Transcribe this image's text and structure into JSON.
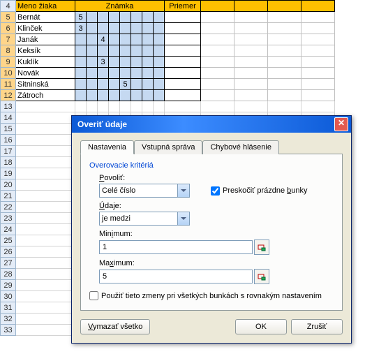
{
  "sheet": {
    "header_row": 4,
    "headers": {
      "name": "Meno žiaka",
      "grades": "Známka",
      "avg": "Priemer"
    },
    "row_numbers": [
      4,
      5,
      6,
      7,
      8,
      9,
      10,
      11,
      12,
      13,
      14,
      15,
      16,
      17,
      18,
      19,
      20,
      21,
      22,
      23,
      24,
      25,
      26,
      27,
      28,
      29,
      30,
      31,
      32,
      33
    ],
    "selected_rows": [
      5,
      6,
      7,
      8,
      9,
      10,
      11,
      12
    ],
    "rows": [
      {
        "n": 5,
        "name": "Bernát",
        "grades": [
          "5",
          "",
          "",
          "",
          "",
          "",
          "",
          ""
        ]
      },
      {
        "n": 6,
        "name": "Klinček",
        "grades": [
          "3",
          "",
          "",
          "",
          "",
          "",
          "",
          ""
        ]
      },
      {
        "n": 7,
        "name": "Janák",
        "grades": [
          "",
          "",
          "4",
          "",
          "",
          "",
          "",
          ""
        ]
      },
      {
        "n": 8,
        "name": "Keksík",
        "grades": [
          "",
          "",
          "",
          "",
          "",
          "",
          "",
          ""
        ]
      },
      {
        "n": 9,
        "name": "Kuklík",
        "grades": [
          "",
          "",
          "3",
          "",
          "",
          "",
          "",
          ""
        ]
      },
      {
        "n": 10,
        "name": "Novák",
        "grades": [
          "",
          "",
          "",
          "",
          "",
          "",
          "",
          ""
        ]
      },
      {
        "n": 11,
        "name": "Sitninská",
        "grades": [
          "",
          "",
          "",
          "",
          "5",
          "",
          "",
          ""
        ]
      },
      {
        "n": 12,
        "name": "Zátroch",
        "grades": [
          "",
          "",
          "",
          "",
          "",
          "",
          "",
          ""
        ]
      }
    ]
  },
  "dialog": {
    "title": "Overiť údaje",
    "tabs": {
      "settings": "Nastavenia",
      "input": "Vstupná správa",
      "error": "Chybové hlásenie"
    },
    "criteria_label": "Overovacie kritériá",
    "allow_label": "Povoliť:",
    "allow_value": "Celé číslo",
    "skip_blank_label": "Preskočiť prázdne bunky",
    "skip_blank_checked": true,
    "data_label": "Údaje:",
    "data_value": "je medzi",
    "min_label": "Minimum:",
    "min_value": "1",
    "max_label": "Maximum:",
    "max_value": "5",
    "apply_label": "Použiť tieto zmeny pri všetkých bunkách s rovnakým nastavením",
    "apply_checked": false,
    "clear_btn": "Vymazať všetko",
    "ok_btn": "OK",
    "cancel_btn": "Zrušiť"
  }
}
